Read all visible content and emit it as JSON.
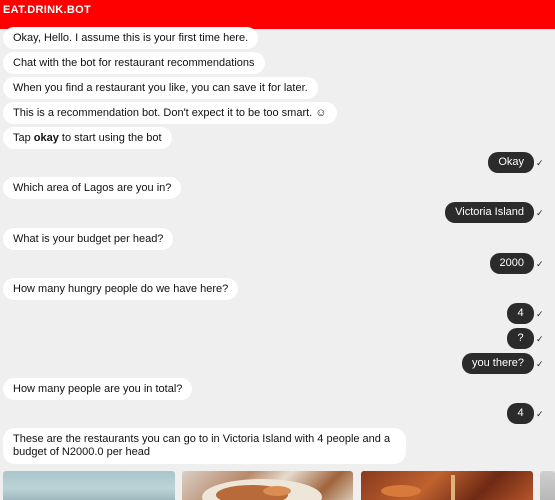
{
  "header": {
    "title": "EAT.DRINK.BOT"
  },
  "messages": {
    "m1": "Okay, Hello. I assume this is your first time here.",
    "m2": "Chat with the bot for restaurant recommendations",
    "m3": "When you find a restaurant you like, you can save it for later.",
    "m4": "This is a recommendation bot. Don't expect it to be too smart. ☺",
    "m5_pre": "Tap ",
    "m5_bold": "okay",
    "m5_post": " to start using the bot",
    "u1": "Okay",
    "m6": "Which area of Lagos are you in?",
    "u2": "Victoria Island",
    "m7": "What is your budget per head?",
    "u3": "2000",
    "m8": "How many hungry people do we have here?",
    "u4": "4",
    "u5": "?",
    "u6": "you there?",
    "m9": "How many people are you in total?",
    "u7": "4",
    "m10": "These are the restaurants you can go to in Victoria Island with 4 people and a budget of N2000.0 per head"
  },
  "status": {
    "delivered_mark": "✓"
  },
  "colors": {
    "header": "#ff0000",
    "user_bubble": "#2b2b2b",
    "bot_bubble": "#ffffff",
    "background": "#efefef"
  }
}
